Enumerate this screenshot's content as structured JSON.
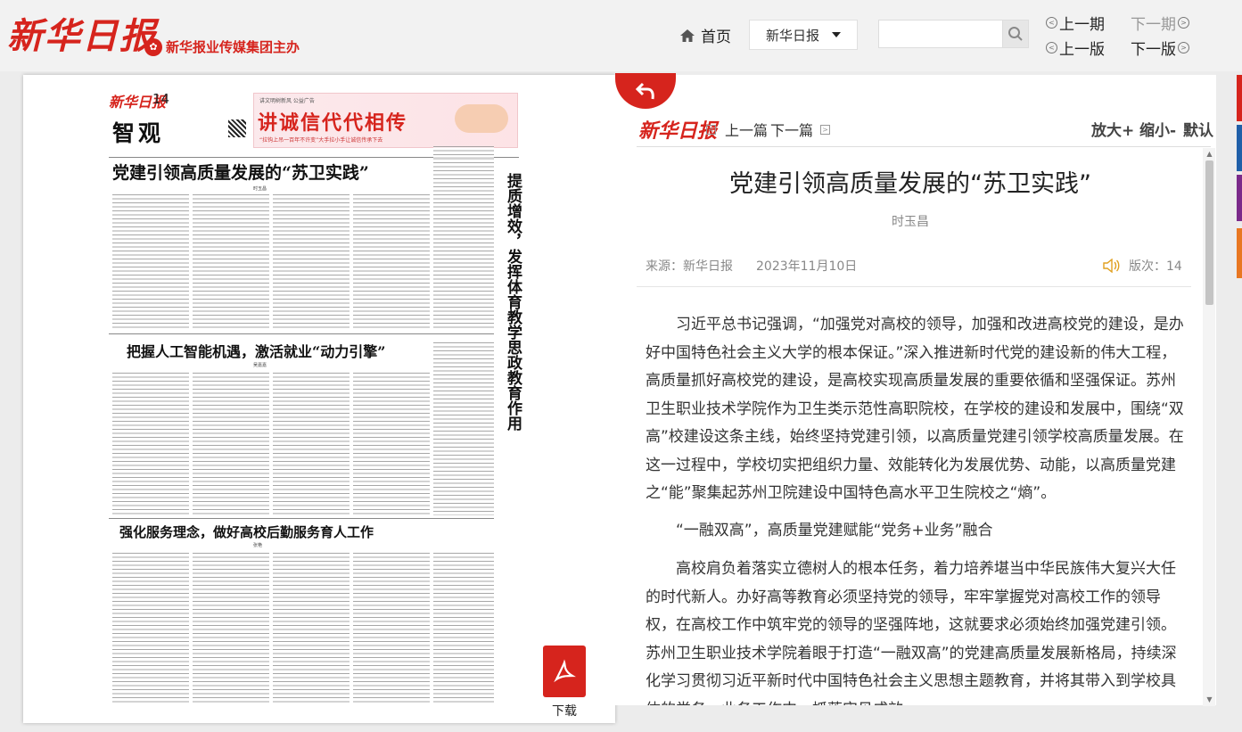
{
  "header": {
    "logo": "新华日报",
    "sublogo": "新华报业传媒集团主办",
    "home_label": "首页",
    "paper_select": "新华日报",
    "search_placeholder": "",
    "prev_issue": "上一期",
    "next_issue": "下一期",
    "prev_page": "上一版",
    "next_page": "下一版"
  },
  "newspaper": {
    "masthead": "新华日报",
    "page_number": "14",
    "section": "智观",
    "ad_small": "讲文明树新风  公益广告",
    "ad_title": "讲诚信代代相传",
    "ad_sub": "“拉钩上吊一百年不许变”大手拉小手让诚信传承下去",
    "headline_1": "党建引领高质量发展的“苏卫实践”",
    "byline_1": "时玉昌",
    "headline_2": "把握人工智能机遇，激活就业“动力引擎”",
    "byline_2": "吴嘉嘉",
    "headline_3": "强化服务理念，做好高校后勤服务育人工作",
    "byline_3": "张艳",
    "vertical_headline": "提质增效，发挥体育教学思政教育作用",
    "download_label": "下载"
  },
  "article": {
    "logo": "新华日报",
    "prev_article": "上一篇",
    "next_article": "下一篇",
    "zoom_in": "放大+",
    "zoom_out": "缩小-",
    "zoom_default": "默认",
    "title": "党建引领高质量发展的“苏卫实践”",
    "author": "时玉昌",
    "source": "来源：新华日报",
    "date": "2023年11月10日",
    "edition": "版次：14",
    "paragraph_1": "习近平总书记强调，“加强党对高校的领导，加强和改进高校党的建设，是办好中国特色社会主义大学的根本保证。”深入推进新时代党的建设新的伟大工程，高质量抓好高校党的建设，是高校实现高质量发展的重要依循和坚强保证。苏州卫生职业技术学院作为卫生类示范性高职院校，在学校的建设和发展中，围绕“双高”校建设这条主线，始终坚持党建引领，以高质量党建引领学校高质量发展。在这一过程中，学校切实把组织力量、效能转化为发展优势、动能，以高质量党建之“能”聚集起苏州卫院建设中国特色高水平卫生院校之“熵”。",
    "subheading_1": "“一融双高”，高质量党建赋能“党务+业务”融合",
    "paragraph_2": "高校肩负着落实立德树人的根本任务，着力培养堪当中华民族伟大复兴大任的时代新人。办好高等教育必须坚持党的领导，牢牢掌握党对高校工作的领导权，在高校工作中筑牢党的领导的坚强阵地，这就要求必须始终加强党建引领。苏州卫生职业技术学院着眼于打造“一融双高”的党建高质量发展新格局，持续深化学习贯彻习近平新时代中国特色社会主义思想主题教育，并将其带入到学校具体的党务、业务工作中，抓落实见成效。"
  },
  "colors": {
    "brand_red": "#d6241d",
    "page_bg": "#ececec"
  }
}
